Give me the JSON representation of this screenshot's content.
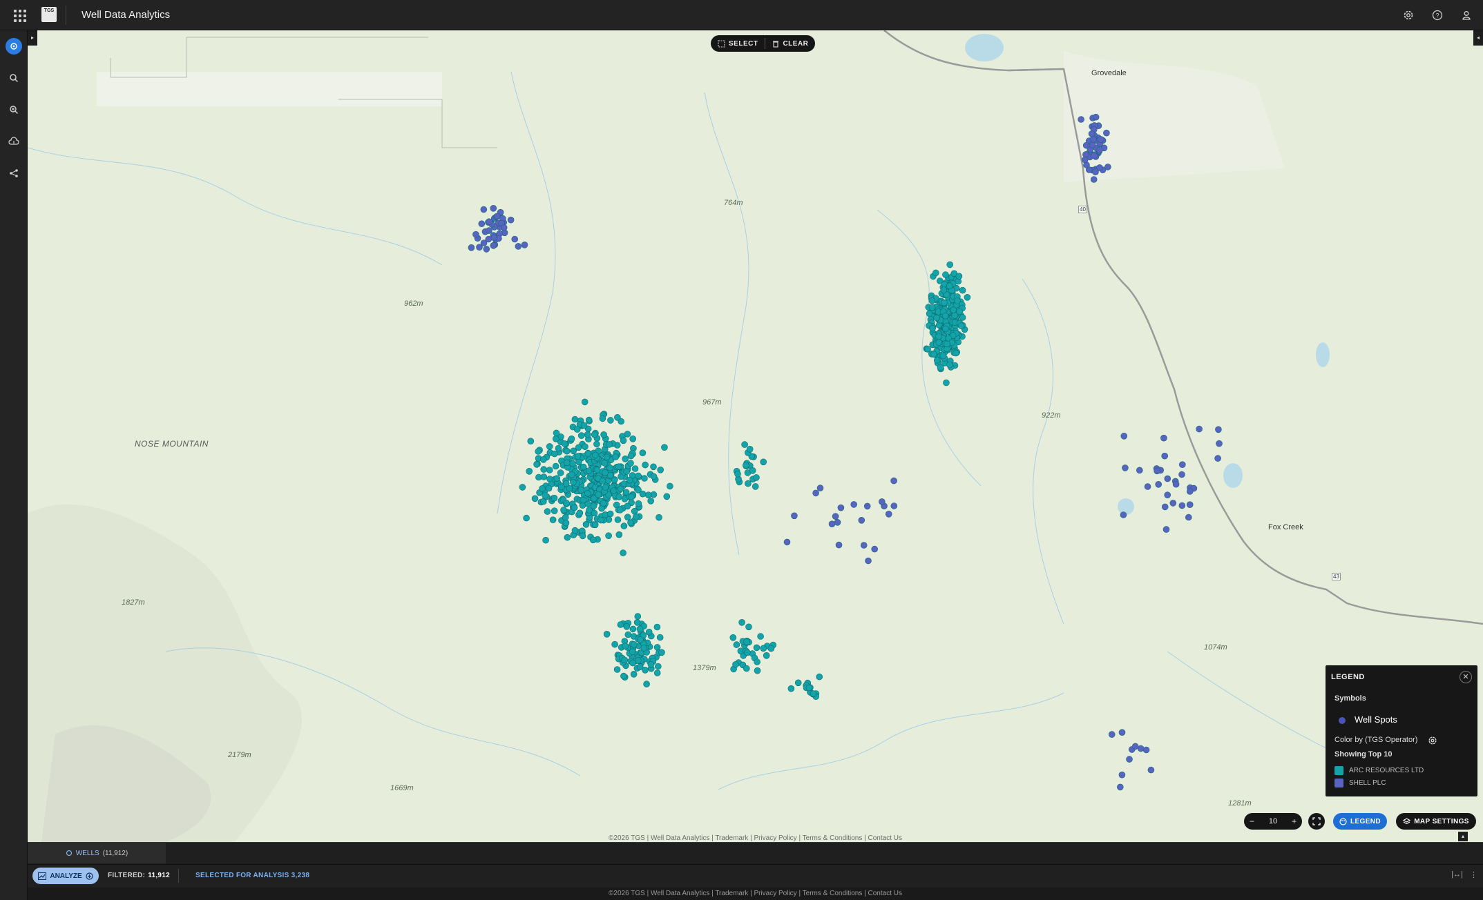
{
  "app": {
    "title": "Well Data Analytics",
    "logo_text": "TGS"
  },
  "map": {
    "select_label": "SELECT",
    "clear_label": "CLEAR",
    "zoom_level": "10",
    "legend_button": "LEGEND",
    "map_settings_button": "MAP SETTINGS",
    "labels": {
      "nose_mountain": "NOSE MOUNTAIN",
      "elev_764": "764m",
      "elev_962": "962m",
      "elev_967": "967m",
      "elev_922": "922m",
      "elev_1827": "1827m",
      "elev_1379": "1379m",
      "elev_1074": "1074m",
      "elev_2179": "2179m",
      "elev_1669": "1669m",
      "elev_1281": "1281m",
      "fox_creek": "Fox Creek",
      "grovedale": "Grovedale",
      "hwy_40": "40",
      "hwy_43": "43"
    },
    "accent": "#2b7de1"
  },
  "legend": {
    "title": "LEGEND",
    "symbols_heading": "Symbols",
    "well_spots": "Well Spots",
    "color_by": "Color by (TGS Operator)",
    "showing": "Showing Top 10",
    "operators": [
      {
        "name": "ARC RESOURCES LTD",
        "color": "#14a3a8"
      },
      {
        "name": "SHELL PLC",
        "color": "#5a62c2"
      }
    ]
  },
  "bottom": {
    "wells_tab_label": "WELLS",
    "wells_tab_count": "(11,912)",
    "analyze_label": "ANALYZE",
    "filtered_label": "FILTERED:",
    "filtered_value": "11,912",
    "selected_label": "SELECTED FOR ANALYSIS 3,238"
  },
  "footer": {
    "text": "©2026 TGS | Well Data Analytics | Trademark | Privacy Policy | Terms & Conditions | Contact Us"
  }
}
